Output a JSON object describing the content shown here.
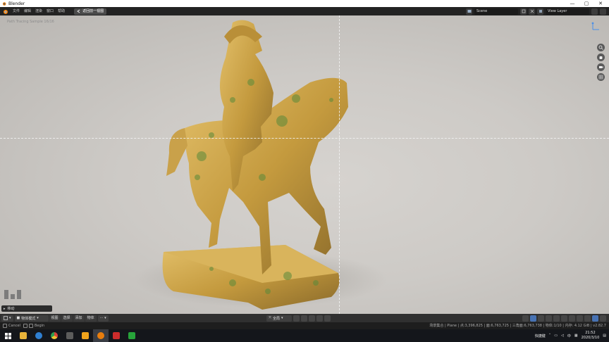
{
  "window": {
    "title": "Blender",
    "min": "—",
    "max": "▢",
    "close": "✕"
  },
  "menu": {
    "items": [
      "文件",
      "编辑",
      "渲染",
      "窗口",
      "帮助"
    ],
    "workspace_tab": "返回前一视图"
  },
  "topbar_right": {
    "scene": "Scene",
    "view_layer": "View Layer"
  },
  "viewport": {
    "overlay_text": "Path Tracing Sample 16/16",
    "last_operation": "移动"
  },
  "vp_header": {
    "mode": "物体模式",
    "menus": [
      "视图",
      "选择",
      "添加",
      "物体"
    ],
    "transform_orientation": "全局"
  },
  "statusbar": {
    "keys": [
      "Cancel",
      "Begin"
    ],
    "stats": "场景集合 | Plane | 点:3,396,825 | 面:6,763,725 | 三角面:6,763,738 | 物体:1/10 | 内存: 4.12 GiB | v2.82.7"
  },
  "taskbar": {
    "apps": [
      {
        "name": "file-explorer",
        "color": "#e8b33a"
      },
      {
        "name": "edge",
        "color": "#2f7fd1"
      },
      {
        "name": "chrome",
        "color": "#d8443a"
      },
      {
        "name": "calculator",
        "color": "#5c5c5c"
      },
      {
        "name": "app-orange",
        "color": "#f0a31c"
      },
      {
        "name": "blender",
        "color": "#e87d0d"
      },
      {
        "name": "app-red",
        "color": "#cc2c2c"
      },
      {
        "name": "camtasia",
        "color": "#27a33a"
      }
    ],
    "ime": "快捷键",
    "lang": "中",
    "time": "21:52",
    "date": "2020/3/10"
  }
}
